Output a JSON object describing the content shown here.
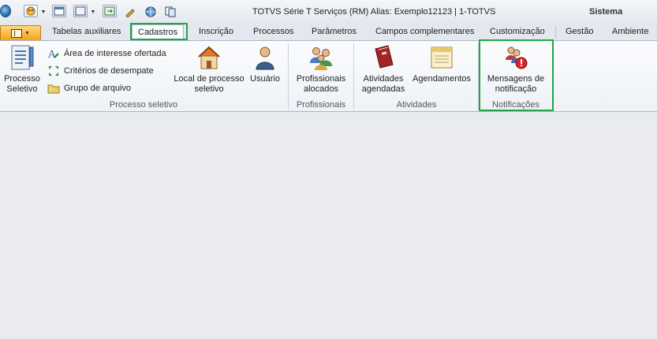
{
  "window": {
    "title": "TOTVS Série T Serviços (RM) Alias: Exemplo12123 | 1-TOTVS",
    "right_label": "Sistema"
  },
  "tabs": [
    {
      "label": "Tabelas auxiliares"
    },
    {
      "label": "Cadastros"
    },
    {
      "label": "Inscrição"
    },
    {
      "label": "Processos"
    },
    {
      "label": "Parâmetros"
    },
    {
      "label": "Campos complementares"
    },
    {
      "label": "Customização"
    },
    {
      "label": "Gestão"
    },
    {
      "label": "Ambiente"
    }
  ],
  "active_tab": "Cadastros",
  "ribbon": {
    "processo_seletivo": {
      "group_label": "Processo seletivo",
      "processo_seletivo_label": "Processo Seletivo",
      "area_interesse_label": "Área de interesse ofertada",
      "criterios_label": "Critérios de desempate",
      "grupo_arquivo_label": "Grupo de arquivo",
      "local_processo_label": "Local de processo seletivo",
      "usuario_label": "Usuário"
    },
    "profissionais": {
      "group_label": "Profissionais",
      "alocados_label": "Profissionais alocados"
    },
    "atividades": {
      "group_label": "Atividades",
      "agendadas_label": "Atividades agendadas",
      "agendamentos_label": "Agendamentos"
    },
    "notificacoes": {
      "group_label": "Notificações",
      "mensagens_label": "Mensagens de notificação"
    }
  },
  "colors": {
    "highlight": "#22a544",
    "file_button": "#f6a21a"
  }
}
